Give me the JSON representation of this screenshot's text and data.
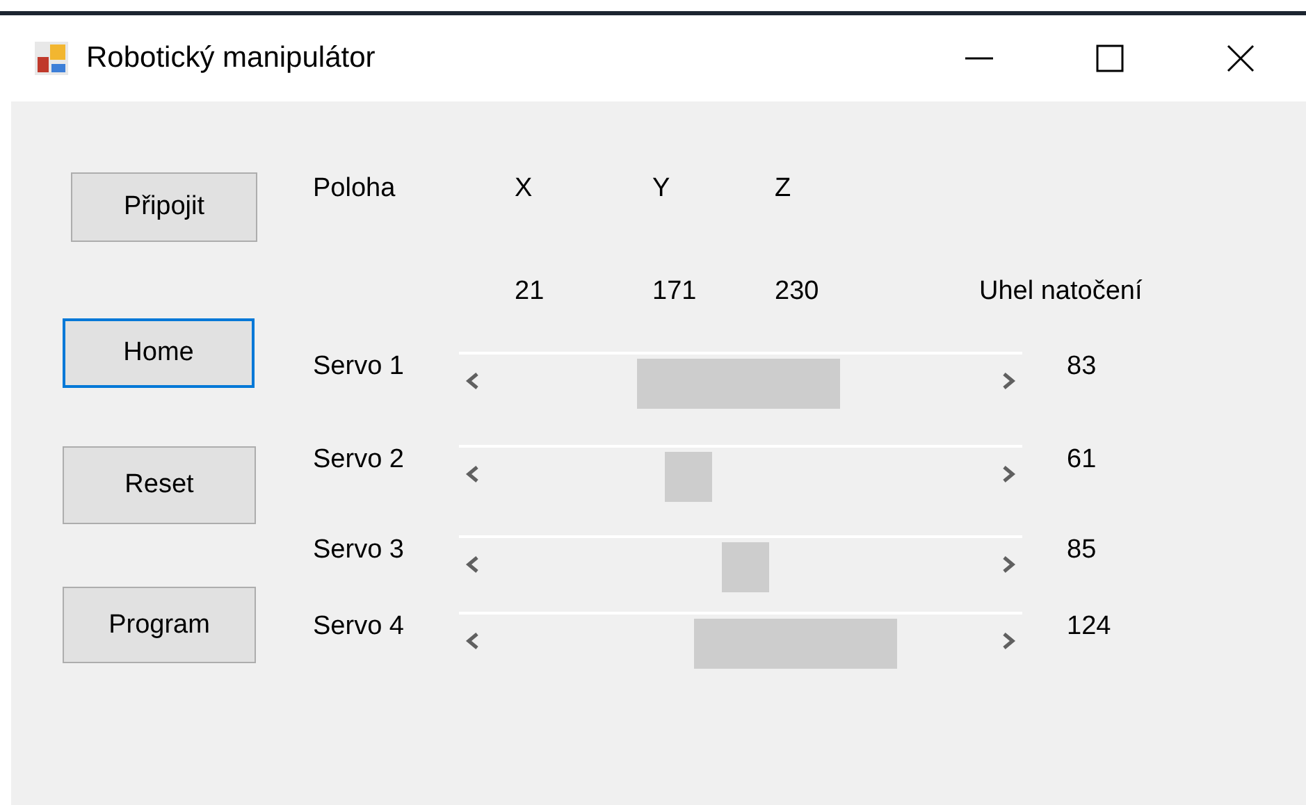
{
  "window": {
    "title": "Robotický manipulátor"
  },
  "buttons": [
    {
      "label": "Připojit",
      "focused": false
    },
    {
      "label": "Home",
      "focused": true
    },
    {
      "label": "Reset",
      "focused": false
    },
    {
      "label": "Program",
      "focused": false
    }
  ],
  "position": {
    "label": "Poloha",
    "axes": [
      {
        "name": "X",
        "value": "21"
      },
      {
        "name": "Y",
        "value": "171"
      },
      {
        "name": "Z",
        "value": "230"
      }
    ]
  },
  "angle_heading": "Uhel natočení",
  "servos": [
    {
      "name": "Servo 1",
      "reading": "83"
    },
    {
      "name": "Servo 2",
      "reading": "61"
    },
    {
      "name": "Servo 3",
      "reading": "85"
    },
    {
      "name": "Servo 4",
      "reading": "124"
    }
  ]
}
